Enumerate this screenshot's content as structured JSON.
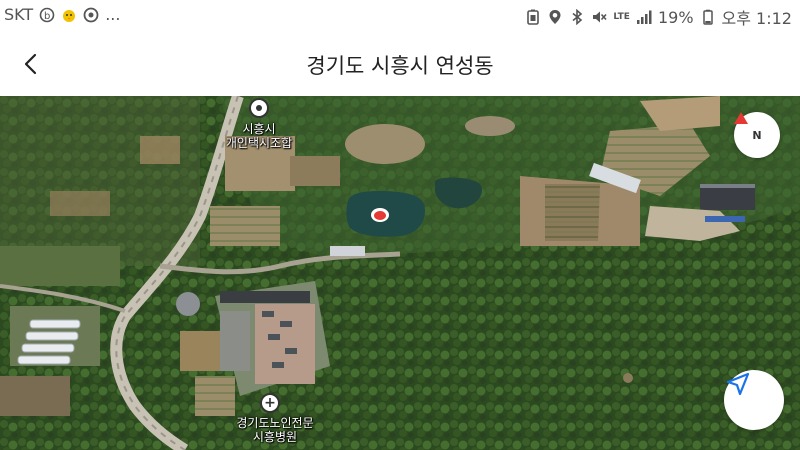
{
  "status_bar": {
    "carrier": "SKT",
    "more": "...",
    "network": "LTE",
    "battery": "19%",
    "time": "오후 1:12"
  },
  "header": {
    "title": "경기도 시흥시 연성동"
  },
  "map": {
    "pois": [
      {
        "line1": "시흥시",
        "line2": "개인택시조합"
      },
      {
        "line1": "경기도노인전문",
        "line2": "시흥병원"
      }
    ],
    "compass_label": "N",
    "marker_color": "#e53935"
  },
  "colors": {
    "accent": "#1a73e8",
    "compass_red": "#e53935"
  },
  "icons": [
    "back-arrow-icon",
    "compass-icon",
    "navigation-arrow-icon",
    "location-marker-icon"
  ]
}
